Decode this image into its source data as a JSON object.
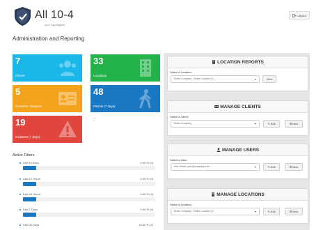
{
  "header": {
    "title": "All 10-4",
    "subtitle": "your logo/tagline",
    "logout_label": "Logout"
  },
  "page": {
    "title": "Administration and Reporting"
  },
  "tiles": [
    {
      "value": "7",
      "label": "Clients",
      "color": "#1ab7ea",
      "icon": "users-icon"
    },
    {
      "value": "33",
      "label": "Locations",
      "color": "#24b24b",
      "icon": "building-icon"
    },
    {
      "value": "5",
      "label": "Cameras / Devices",
      "color": "#f5a31c",
      "icon": "id-card-icon"
    },
    {
      "value": "48",
      "label": "Patrols (7 days)",
      "color": "#1a78c2",
      "icon": "walking-icon"
    },
    {
      "value": "19",
      "label": "Incidents (7 days)",
      "color": "#e0463e",
      "icon": "warning-icon"
    }
  ],
  "active_filters": {
    "title": "Active Filters",
    "items": [
      {
        "name": "Last 6 Hours",
        "value": "0.00 % (0)",
        "fraction": 0.1
      },
      {
        "name": "Last 12 Hours",
        "value": "0.00 % (0)",
        "fraction": 0.1
      },
      {
        "name": "Last 24 Hours",
        "value": "0.00 % (0)",
        "fraction": 0.1
      },
      {
        "name": "Last 7 Days",
        "value": "0.00 % (0)",
        "fraction": 0.1
      },
      {
        "name": "Last 30 Days",
        "value": "10.00 % (2)",
        "fraction": 0.1
      }
    ]
  },
  "panels": {
    "location_reports": {
      "title": "LOCATION REPORTS",
      "field_label": "Select a Location:",
      "select_value": "Entire Company - Entire Location (1)",
      "view_label": "View"
    },
    "manage_clients": {
      "title": "MANAGE CLIENTS",
      "field_label": "Select a Client:",
      "select_value": "Entire Company",
      "edit_label": "Edit",
      "new_label": "New"
    },
    "manage_users": {
      "title": "MANAGE USERS",
      "field_label": "Select a User:",
      "select_value": "Ellie Shane, john@company.com",
      "edit_label": "Edit",
      "new_label": "New"
    },
    "manage_locations": {
      "title": "MANAGE LOCATIONS",
      "field_label": "Select a Location:",
      "select_value": "Entire Company - Entire Location (1)",
      "edit_label": "Edit",
      "new_label": "New"
    }
  }
}
